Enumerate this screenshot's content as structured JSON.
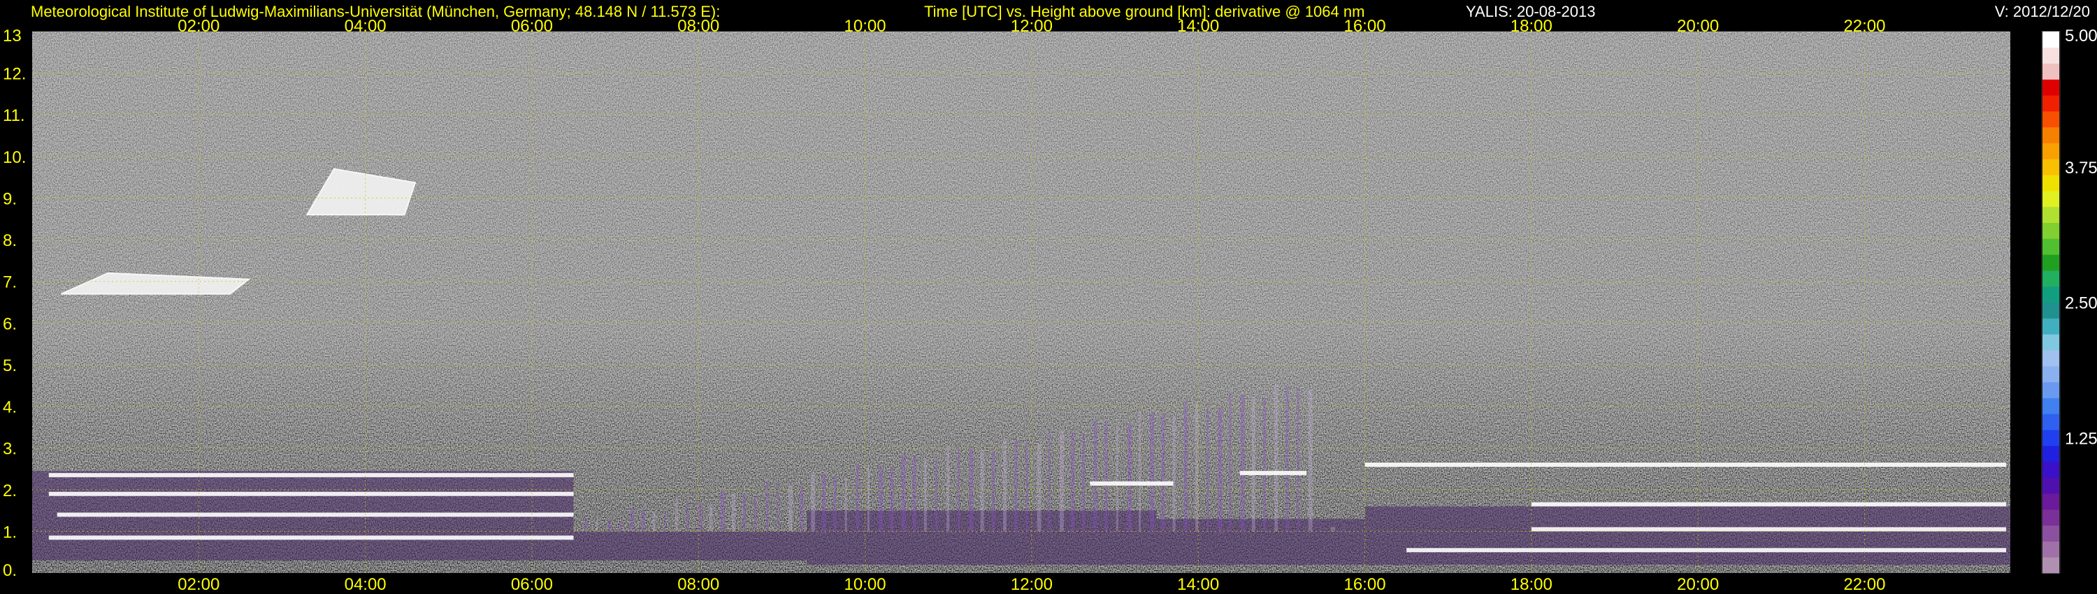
{
  "header": {
    "institute": "Meteorological Institute of Ludwig-Maximilians-Universität (München, Germany; 48.148 N / 11.573 E):",
    "description": "Time [UTC] vs. Height above ground [km]: derivative @ 1064 nm",
    "instrument": "YALIS: 20-08-2013",
    "version": "V: 2012/12/20"
  },
  "colors": {
    "text": "#ffff00",
    "header_white": "#ffffff",
    "grid": "#c8c800",
    "background": "#000000",
    "noise_light": "#d0d0d0",
    "noise_dark": "#2a2a2a"
  },
  "chart_data": {
    "type": "heatmap",
    "title": "",
    "xlabel": "Time [UTC]",
    "ylabel": "Height above ground [km]",
    "x_ticks": [
      "02:00",
      "04:00",
      "06:00",
      "08:00",
      "10:00",
      "12:00",
      "14:00",
      "16:00",
      "18:00",
      "20:00",
      "22:00"
    ],
    "x_tick_hours": [
      2,
      4,
      6,
      8,
      10,
      12,
      14,
      16,
      18,
      20,
      22
    ],
    "xlim_hours": [
      0,
      23.75
    ],
    "y_ticks": [
      "0.",
      "1.",
      "2.",
      "3.",
      "4.",
      "5.",
      "6.",
      "7.",
      "8.",
      "9.",
      "10.",
      "11.",
      "12.",
      "13"
    ],
    "y_tick_values": [
      0,
      1,
      2,
      3,
      4,
      5,
      6,
      7,
      8,
      9,
      10,
      11,
      12,
      13
    ],
    "ylim_km": [
      0,
      13
    ],
    "grid": true,
    "colorbar": {
      "labels": [
        "5.00",
        "3.75",
        "2.50",
        "1.25"
      ],
      "label_values": [
        5.0,
        3.75,
        2.5,
        1.25
      ],
      "range": [
        0,
        5.0
      ],
      "colors": [
        "#b090b0",
        "#a070a8",
        "#8c50a0",
        "#7a3098",
        "#6a1a9a",
        "#5010b0",
        "#3a10c8",
        "#2020e0",
        "#2040f0",
        "#3060f0",
        "#4080f0",
        "#6a9af0",
        "#8ab0f0",
        "#a0c0f0",
        "#80c8e0",
        "#40b0c0",
        "#209090",
        "#10a080",
        "#20b060",
        "#20a020",
        "#50c030",
        "#80d030",
        "#b0e030",
        "#e0f020",
        "#f0e000",
        "#f8c000",
        "#f8a000",
        "#f88000",
        "#f85000",
        "#f02000",
        "#e00000",
        "#f0c0c0",
        "#f8e0e0",
        "#ffffff"
      ]
    },
    "features": {
      "boundary_layer": [
        {
          "start": 0.0,
          "end": 6.5,
          "base": 0.3,
          "top": 2.45
        },
        {
          "start": 6.5,
          "end": 9.3,
          "base": 0.3,
          "top": 1.0
        },
        {
          "start": 9.3,
          "end": 13.5,
          "base": 0.2,
          "top": 1.5
        },
        {
          "start": 13.5,
          "end": 16.0,
          "base": 0.2,
          "top": 1.3
        },
        {
          "start": 16.0,
          "end": 23.75,
          "base": 0.2,
          "top": 1.6
        }
      ],
      "layer_lines": [
        {
          "start": 0.2,
          "end": 6.5,
          "height": 2.35
        },
        {
          "start": 0.2,
          "end": 6.5,
          "height": 1.9
        },
        {
          "start": 0.3,
          "end": 6.5,
          "height": 1.4
        },
        {
          "start": 0.2,
          "end": 6.5,
          "height": 0.85
        },
        {
          "start": 12.7,
          "end": 13.7,
          "height": 2.15
        },
        {
          "start": 14.5,
          "end": 15.3,
          "height": 2.4
        },
        {
          "start": 16.0,
          "end": 23.7,
          "height": 2.6
        },
        {
          "start": 18.0,
          "end": 23.7,
          "height": 1.65
        },
        {
          "start": 18.0,
          "end": 23.7,
          "height": 1.05
        },
        {
          "start": 16.5,
          "end": 23.7,
          "height": 0.55
        }
      ],
      "cloud_layers": [
        {
          "start": 0.35,
          "end": 2.6,
          "base": 6.7,
          "top": 7.2
        },
        {
          "start": 3.3,
          "end": 4.6,
          "base": 8.6,
          "top": 9.7
        }
      ],
      "convective_plumes": [
        {
          "start": 6.5,
          "end": 16.0,
          "top": 4.6
        }
      ]
    }
  }
}
